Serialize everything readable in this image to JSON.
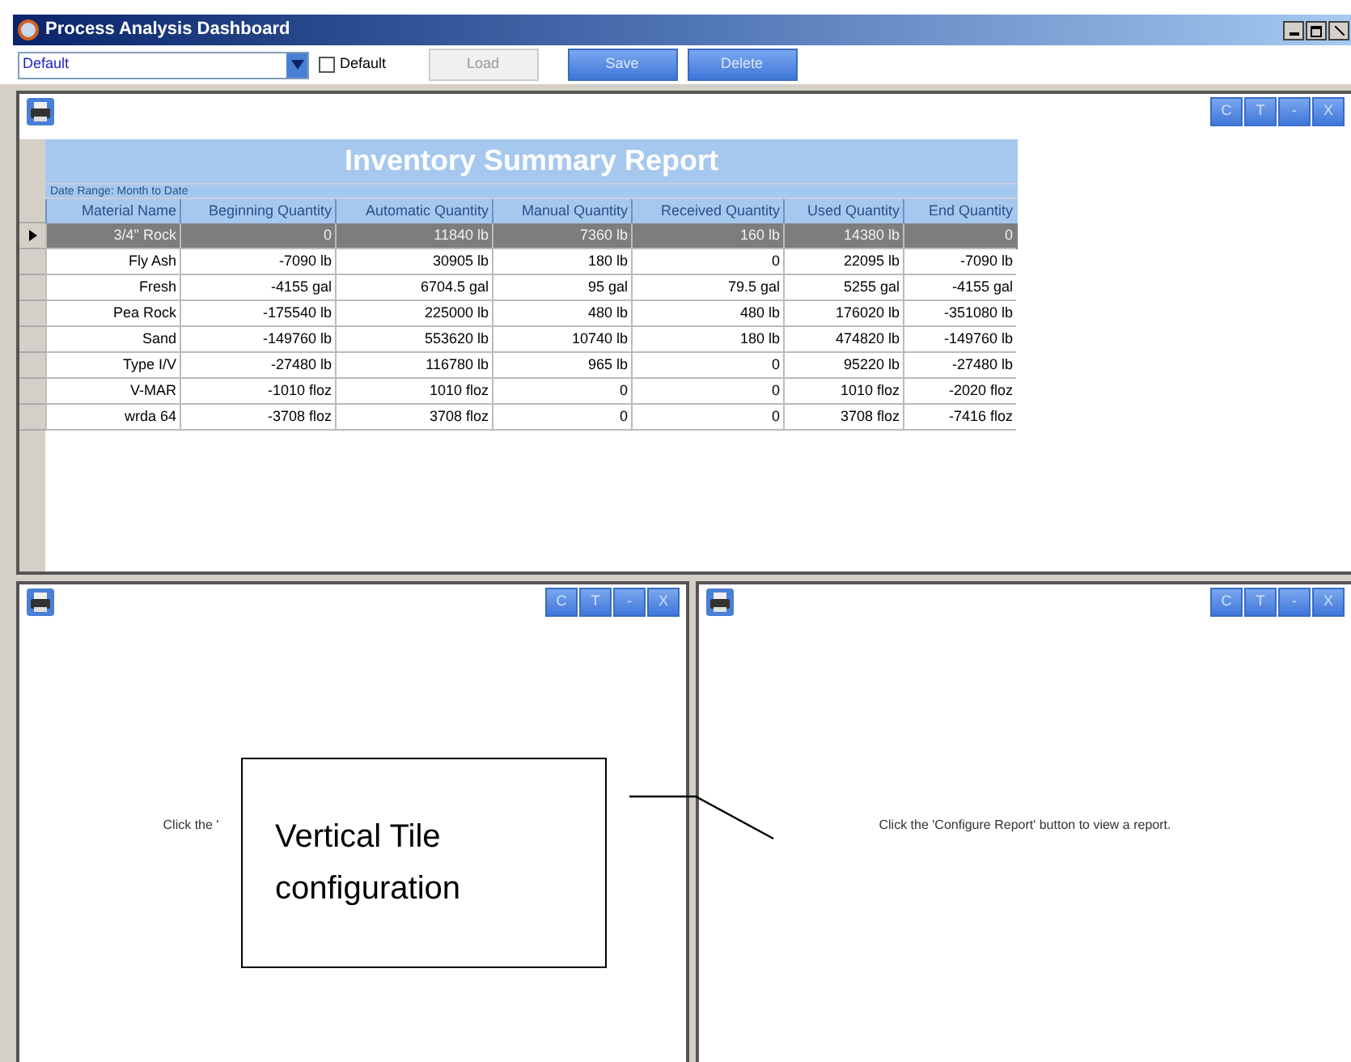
{
  "window": {
    "title": "Process Analysis Dashboard"
  },
  "toolbar": {
    "layout_select": {
      "value": "Default"
    },
    "default_checkbox": {
      "label": "Default",
      "checked": false
    },
    "buttons": [
      {
        "label": "Load",
        "disabled": true
      },
      {
        "label": "Save",
        "disabled": false
      },
      {
        "label": "Delete",
        "disabled": false
      }
    ]
  },
  "panels": [
    {
      "buttons": [
        "C",
        "T",
        "-",
        "X"
      ],
      "report": {
        "title": "Inventory Summary Report",
        "date_range": "Date Range: Month to Date",
        "columns": [
          "Material Name",
          "Beginning Quantity",
          "Automatic Quantity",
          "Manual Quantity",
          "Received Quantity",
          "Used Quantity",
          "End Quantity"
        ],
        "rows": [
          {
            "selected": true,
            "cells": [
              "3/4\" Rock",
              "0",
              "11840 lb",
              "7360 lb",
              "160 lb",
              "14380 lb",
              "0"
            ]
          },
          {
            "selected": false,
            "cells": [
              "Fly Ash",
              "-7090 lb",
              "30905 lb",
              "180 lb",
              "0",
              "22095 lb",
              "-7090 lb"
            ]
          },
          {
            "selected": false,
            "cells": [
              "Fresh",
              "-4155 gal",
              "6704.5 gal",
              "95 gal",
              "79.5 gal",
              "5255 gal",
              "-4155 gal"
            ]
          },
          {
            "selected": false,
            "cells": [
              "Pea Rock",
              "-175540 lb",
              "225000 lb",
              "480 lb",
              "480 lb",
              "176020 lb",
              "-351080 lb"
            ]
          },
          {
            "selected": false,
            "cells": [
              "Sand",
              "-149760 lb",
              "553620 lb",
              "10740 lb",
              "180 lb",
              "474820 lb",
              "-149760 lb"
            ]
          },
          {
            "selected": false,
            "cells": [
              "Type I/V",
              "-27480 lb",
              "116780 lb",
              "965 lb",
              "0",
              "95220 lb",
              "-27480 lb"
            ]
          },
          {
            "selected": false,
            "cells": [
              "V-MAR",
              "-1010 floz",
              "1010 floz",
              "0",
              "0",
              "1010 floz",
              "-2020 floz"
            ]
          },
          {
            "selected": false,
            "cells": [
              "wrda 64",
              "-3708 floz",
              "3708 floz",
              "0",
              "0",
              "3708 floz",
              "-7416 floz"
            ]
          }
        ]
      }
    },
    {
      "buttons": [
        "C",
        "T",
        "-",
        "X"
      ],
      "message": "Click the '"
    },
    {
      "buttons": [
        "C",
        "T",
        "-",
        "X"
      ],
      "message": "Click the 'Configure Report' button to view a report."
    }
  ],
  "callout": {
    "text": "Vertical Tile configuration"
  }
}
